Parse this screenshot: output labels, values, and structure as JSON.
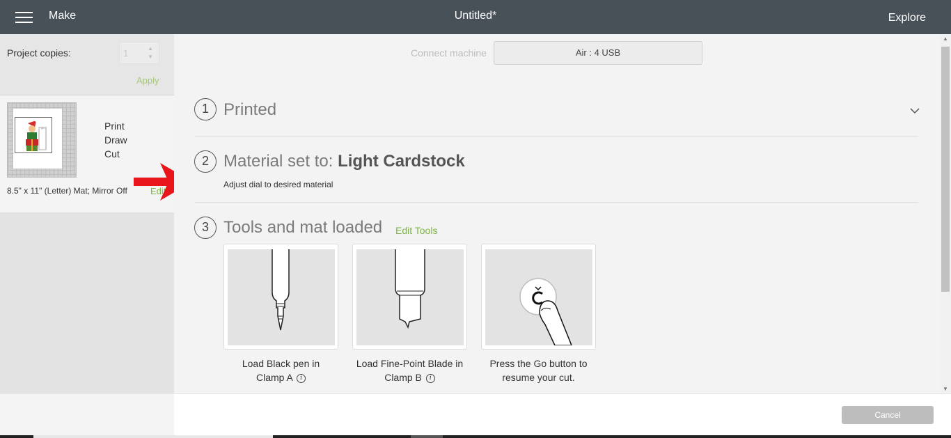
{
  "header": {
    "menu_icon": "hamburger-menu-icon",
    "section_title": "Make",
    "document_title": "Untitled*",
    "explore_label": "Explore"
  },
  "sidebar": {
    "copies_label": "Project copies:",
    "copies_value": "1",
    "apply_label": "Apply",
    "mat": {
      "operations": [
        "Print",
        "Draw",
        "Cut"
      ],
      "info": "8.5\" x 11\" (Letter) Mat; Mirror Off",
      "edit_label": "Edit"
    }
  },
  "main": {
    "connect_label": "Connect machine",
    "machine_value": "Air : 4 USB",
    "steps": [
      {
        "number": "1",
        "title": "Printed"
      },
      {
        "number": "2",
        "title_prefix": "Material set to: ",
        "title_bold": "Light Cardstock",
        "subtitle": "Adjust dial to desired material"
      },
      {
        "number": "3",
        "title": "Tools and mat loaded",
        "action_label": "Edit Tools"
      }
    ],
    "tool_cards": [
      {
        "icon": "black-pen-icon",
        "line1": "Load Black pen in",
        "line2": "Clamp A",
        "info": "i"
      },
      {
        "icon": "fine-point-blade-icon",
        "line1": "Load Fine-Point Blade in",
        "line2": "Clamp B",
        "info": "i"
      },
      {
        "icon": "go-button-press-icon",
        "line1": "Press the Go button to",
        "line2": "resume your cut."
      }
    ]
  },
  "footer": {
    "cancel_label": "Cancel"
  },
  "colors": {
    "header_bg": "#485058",
    "accent_green": "#7cb342",
    "arrow_red": "#e8161b"
  }
}
